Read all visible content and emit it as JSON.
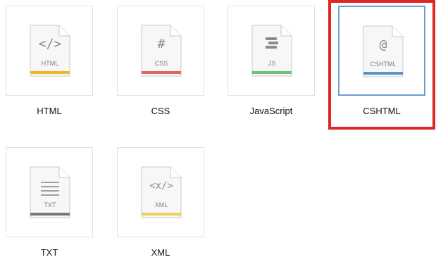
{
  "tiles": [
    {
      "label": "HTML",
      "ext": "HTML",
      "glyph": "</>",
      "bar": "#f0b429"
    },
    {
      "label": "CSS",
      "ext": "CSS",
      "glyph": "#",
      "bar": "#e06666"
    },
    {
      "label": "JavaScript",
      "ext": "JS",
      "glyph": "",
      "bar": "#6fbf7a"
    },
    {
      "label": "CSHTML",
      "ext": "CSHTML",
      "glyph": "@",
      "bar": "#5b8fc8",
      "selected": true
    },
    {
      "label": "TXT",
      "ext": "TXT",
      "glyph": "",
      "bar": "#777777"
    },
    {
      "label": "XML",
      "ext": "XML",
      "glyph": "<x/>",
      "bar": "#e8d35a"
    }
  ]
}
